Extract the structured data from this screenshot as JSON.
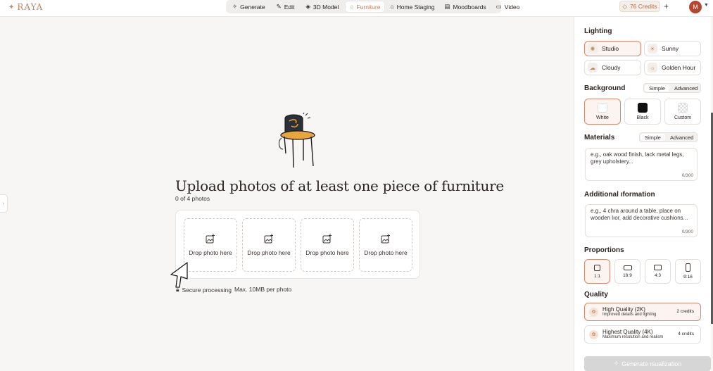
{
  "brand": {
    "logo": "RAYA"
  },
  "nav": {
    "items": [
      {
        "label": "Generate",
        "icon": "sparkle-icon",
        "active": false
      },
      {
        "label": "Edit",
        "icon": "pencil-icon",
        "active": false
      },
      {
        "label": "3D Model",
        "icon": "cube-icon",
        "active": false
      },
      {
        "label": "Furniture",
        "icon": "armchair-icon",
        "active": true
      },
      {
        "label": "Home Staging",
        "icon": "house-icon",
        "active": false
      },
      {
        "label": "Moodboards",
        "icon": "board-icon",
        "active": false
      },
      {
        "label": "Video",
        "icon": "video-icon",
        "active": false
      }
    ]
  },
  "account": {
    "credits": "76 Credits",
    "avatar": "M"
  },
  "main": {
    "headline": "Upload photos of at least one piece of furniture",
    "count": "0 of 4 photos",
    "slots": [
      "Drop photo here",
      "Drop photo here",
      "Drop photo here",
      "Drop photo here"
    ],
    "secure": "Secure processing",
    "max": "Max. 10MB per photo"
  },
  "panel": {
    "lighting": {
      "title": "Lighting",
      "options": [
        {
          "label": "Studio",
          "selected": true
        },
        {
          "label": "Sunny",
          "selected": false
        },
        {
          "label": "Cloudy",
          "selected": false
        },
        {
          "label": "Golden Hour",
          "selected": false
        }
      ]
    },
    "background": {
      "title": "Background",
      "modes": [
        "Simple",
        "Advanced"
      ],
      "options": [
        {
          "label": "White",
          "selected": true
        },
        {
          "label": "Black",
          "selected": false
        },
        {
          "label": "Custom",
          "selected": false
        }
      ]
    },
    "materials": {
      "title": "Materials",
      "modes": [
        "Simple",
        "Advanced"
      ],
      "placeholder": "e.g., oak wood finish, lack metal legs, grey upholstery...",
      "counter": "0/300"
    },
    "additional": {
      "title": "Additional ıformation",
      "placeholder": "e.g., 4 chra around a table, place on wooden lıor, add decorative cushions...",
      "counter": "0/300"
    },
    "proportions": {
      "title": "Proportions",
      "options": [
        {
          "label": "1:1",
          "selected": true
        },
        {
          "label": "16:9",
          "selected": false
        },
        {
          "label": "4:3",
          "selected": false
        },
        {
          "label": "9:16",
          "selected": false
        }
      ]
    },
    "quality": {
      "title": "Quality",
      "options": [
        {
          "title": "High Quality (2K)",
          "subtitle": "Improved details and lighting",
          "credits": "2 credits",
          "selected": true
        },
        {
          "title": "Highest Quality (4K)",
          "subtitle": "Maximum resolution and realism",
          "credits": "4 crıdits",
          "selected": false
        }
      ]
    },
    "generate": "Generate ısualization"
  }
}
